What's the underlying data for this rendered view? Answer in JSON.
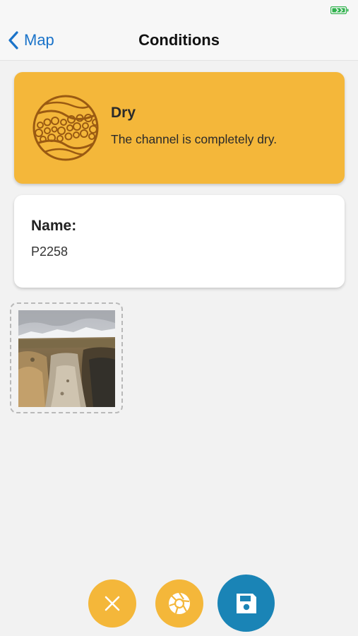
{
  "nav": {
    "back_label": "Map",
    "title": "Conditions"
  },
  "condition": {
    "title": "Dry",
    "description": "The channel is completely dry.",
    "icon": "dry-channel-icon",
    "color": "#f4b73a"
  },
  "name_card": {
    "label": "Name:",
    "value": "P2258"
  },
  "photos": [
    {
      "icon": "photo-thumbnail"
    }
  ],
  "actions": {
    "cancel_icon": "close-icon",
    "camera_icon": "camera-shutter-icon",
    "save_icon": "save-icon",
    "accent_color": "#f4b73a",
    "primary_color": "#1a84b6"
  },
  "colors": {
    "link": "#1a73c9",
    "battery": "#2fb24c",
    "background": "#f2f2f2"
  }
}
